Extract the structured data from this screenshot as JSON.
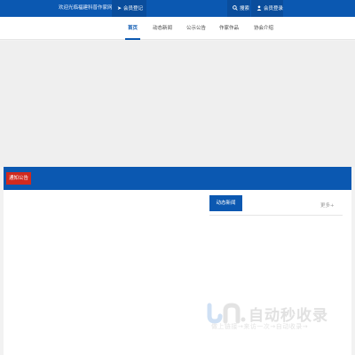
{
  "topbar": {
    "welcome": "欢迎光临福建科普作家网",
    "register_icon": "send-icon",
    "register_label": "会员登记",
    "search_icon": "search-icon",
    "search_label": "搜索",
    "login_icon": "user-icon",
    "login_label": "会员登录"
  },
  "nav": {
    "items": [
      {
        "label": "首页",
        "active": true
      },
      {
        "label": "动态新闻",
        "active": false
      },
      {
        "label": "公示公告",
        "active": false
      },
      {
        "label": "作家作品",
        "active": false
      },
      {
        "label": "协会介绍",
        "active": false
      }
    ]
  },
  "notice": {
    "label": "通知公告"
  },
  "news": {
    "tab_label": "动态新闻",
    "more_label": "更多+"
  },
  "watermark": {
    "title": "自动秒收录",
    "subtitle": "做上链接→来访一次→自动收录→"
  },
  "colors": {
    "primary": "#0b58b1",
    "notice_red": "#d02a1e"
  }
}
